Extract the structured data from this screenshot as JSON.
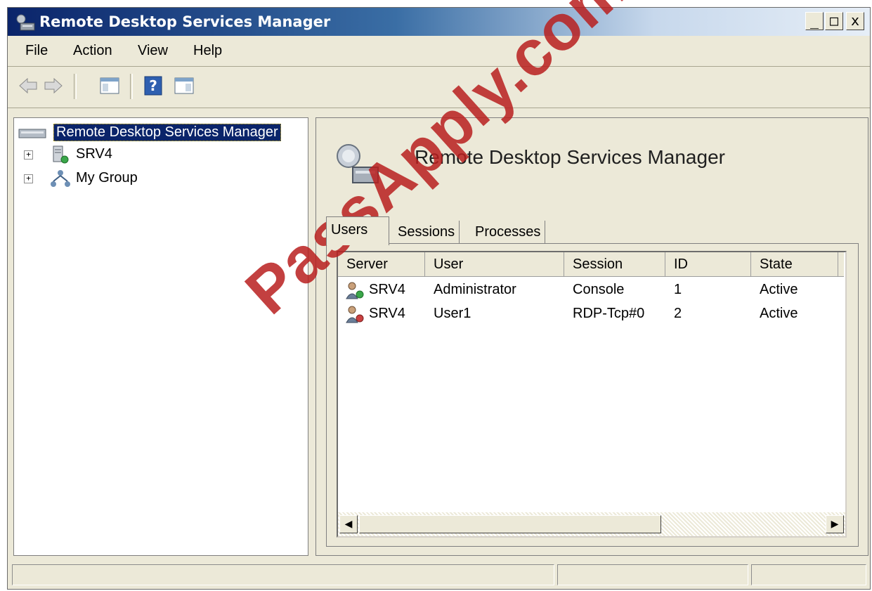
{
  "window": {
    "title": "Remote Desktop Services Manager",
    "controls": {
      "minimize": "_",
      "maximize": "□",
      "close": "x"
    }
  },
  "menu": [
    "File",
    "Action",
    "View",
    "Help"
  ],
  "toolbar": {
    "icons": [
      "back-arrow-icon",
      "forward-arrow-icon",
      "show-hide-console-tree-icon",
      "help-icon",
      "show-hide-action-pane-icon"
    ]
  },
  "tree": {
    "root": "Remote Desktop Services Manager",
    "nodes": [
      {
        "label": "SRV4",
        "icon": "server-icon"
      },
      {
        "label": "My Group",
        "icon": "group-icon"
      }
    ]
  },
  "main": {
    "header_title": "Remote Desktop Services Manager",
    "tabs": [
      "Users",
      "Sessions",
      "Processes"
    ],
    "active_tab": "Users",
    "columns": [
      "Server",
      "User",
      "Session",
      "ID",
      "State"
    ],
    "rows": [
      {
        "server": "SRV4",
        "user": "Administrator",
        "session": "Console",
        "id": "1",
        "state": "Active"
      },
      {
        "server": "SRV4",
        "user": "User1",
        "session": "RDP-Tcp#0",
        "id": "2",
        "state": "Active"
      }
    ]
  },
  "watermark": "PassApply.com",
  "colors": {
    "title_bar": "#0a246a",
    "selection": "#0a246a",
    "watermark": "#b91e1e"
  }
}
